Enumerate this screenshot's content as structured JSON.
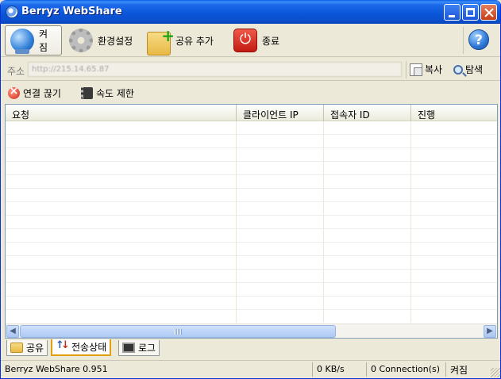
{
  "window": {
    "title": "Berryz WebShare"
  },
  "toolbar": {
    "on_label": "켜짐",
    "settings_label": "환경설정",
    "add_share_label": "공유 추가",
    "exit_label": "종료",
    "help_label": "?"
  },
  "address": {
    "label": "주소",
    "value": "http://215.14.65.87",
    "copy_label": "복사",
    "explore_label": "탐색"
  },
  "actions": {
    "disconnect_label": "연결 끊기",
    "speed_limit_label": "속도 제한"
  },
  "list": {
    "columns": [
      "요청",
      "클라이언트 IP",
      "접속자 ID",
      "진행"
    ]
  },
  "tabs": {
    "share_label": "공유",
    "transfer_label": "전송상태",
    "log_label": "로그"
  },
  "status": {
    "app_version": "Berryz WebShare 0.951",
    "rate": "0 KB/s",
    "connections": "0 Connection(s)",
    "state": "켜짐"
  }
}
